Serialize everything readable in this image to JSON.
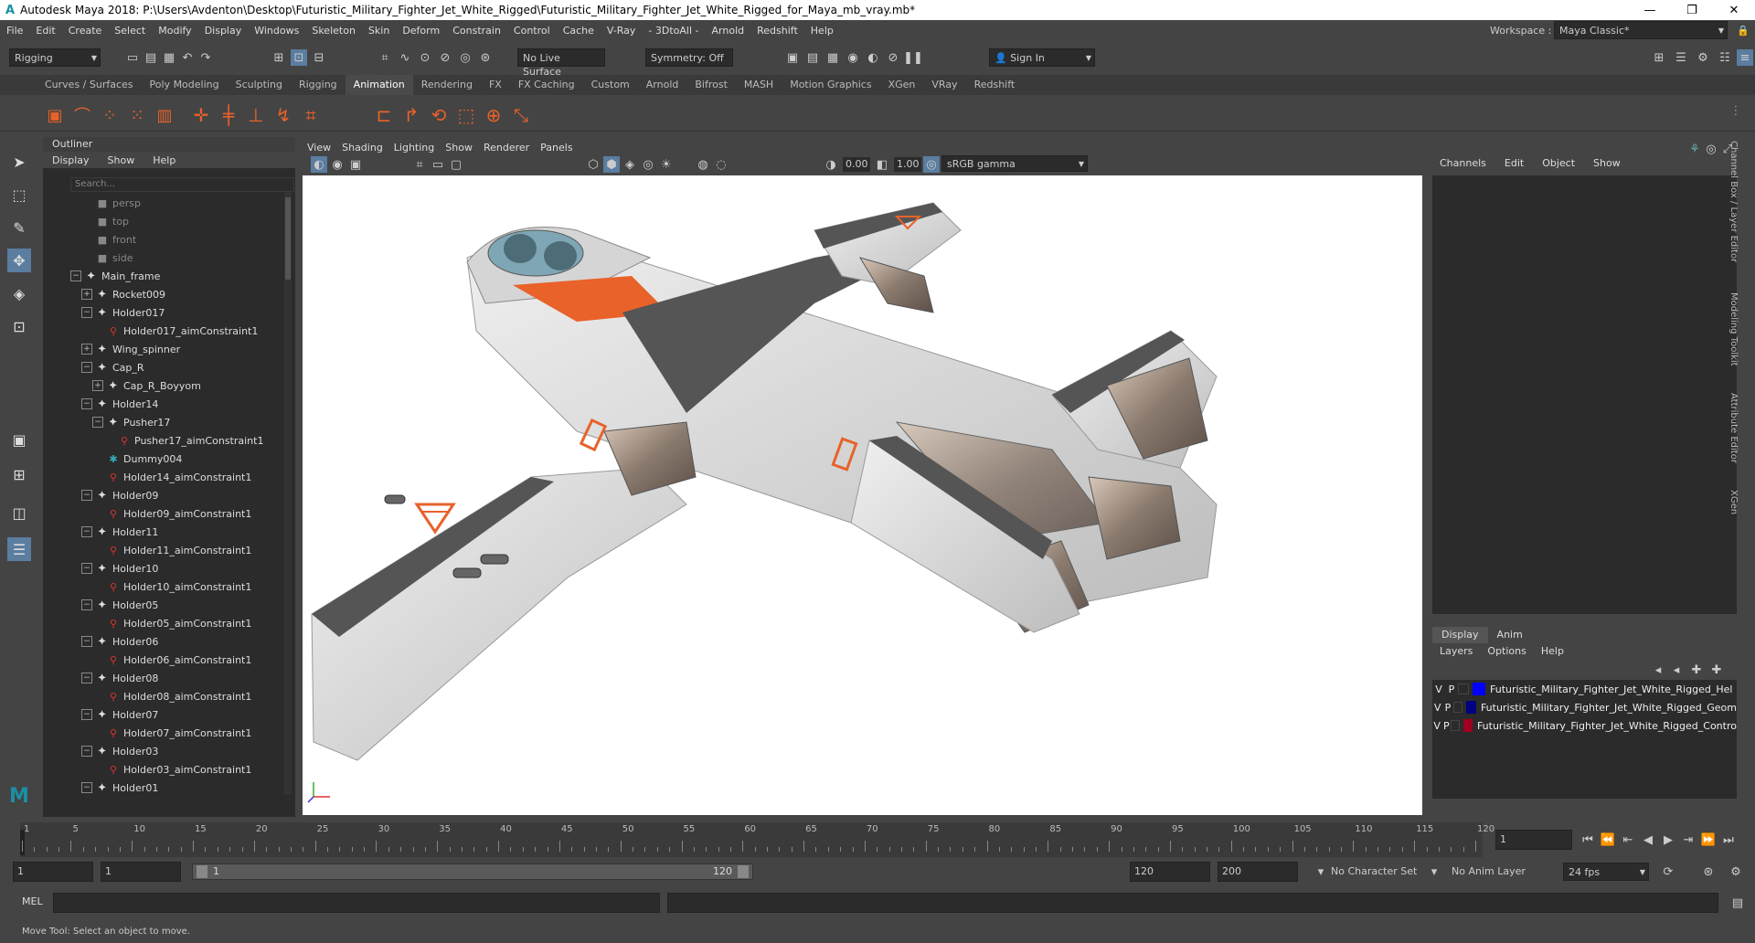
{
  "window": {
    "title": "Autodesk Maya 2018: P:\\Users\\Avdenton\\Desktop\\Futuristic_Military_Fighter_Jet_White_Rigged\\Futuristic_Military_Fighter_Jet_White_Rigged_for_Maya_mb_vray.mb*",
    "logo": "A"
  },
  "menubar": [
    "File",
    "Edit",
    "Create",
    "Select",
    "Modify",
    "Display",
    "Windows",
    "Skeleton",
    "Skin",
    "Deform",
    "Constrain",
    "Control",
    "Cache",
    "V-Ray",
    "- 3DtoAll -",
    "Arnold",
    "Redshift",
    "Help"
  ],
  "workspace": {
    "label": "Workspace :",
    "value": "Maya Classic*"
  },
  "statusline": {
    "mode": "Rigging",
    "live_surface": "No Live Surface",
    "symmetry": "Symmetry: Off",
    "sign_in": "Sign In"
  },
  "shelf_tabs": [
    "Curves / Surfaces",
    "Poly Modeling",
    "Sculpting",
    "Rigging",
    "Animation",
    "Rendering",
    "FX",
    "FX Caching",
    "Custom",
    "Arnold",
    "Bifrost",
    "MASH",
    "Motion Graphics",
    "XGen",
    "VRay",
    "Redshift"
  ],
  "active_shelf_tab": "Animation",
  "outliner": {
    "title": "Outliner",
    "menu": [
      "Display",
      "Show",
      "Help"
    ],
    "search_placeholder": "Search...",
    "items": [
      {
        "label": "persp",
        "depth": 1,
        "icon": "camera",
        "dim": true
      },
      {
        "label": "top",
        "depth": 1,
        "icon": "camera",
        "dim": true
      },
      {
        "label": "front",
        "depth": 1,
        "icon": "camera",
        "dim": true
      },
      {
        "label": "side",
        "depth": 1,
        "icon": "camera",
        "dim": true
      },
      {
        "label": "Main_frame",
        "depth": 0,
        "icon": "transform",
        "expand": "-"
      },
      {
        "label": "Rocket009",
        "depth": 1,
        "icon": "transform",
        "expand": "+"
      },
      {
        "label": "Holder017",
        "depth": 1,
        "icon": "transform",
        "expand": "-"
      },
      {
        "label": "Holder017_aimConstraint1",
        "depth": 2,
        "icon": "constraint"
      },
      {
        "label": "Wing_spinner",
        "depth": 1,
        "icon": "transform",
        "expand": "+"
      },
      {
        "label": "Cap_R",
        "depth": 1,
        "icon": "transform",
        "expand": "-"
      },
      {
        "label": "Cap_R_Boyyom",
        "depth": 2,
        "icon": "transform",
        "expand": "+"
      },
      {
        "label": "Holder14",
        "depth": 1,
        "icon": "transform",
        "expand": "-"
      },
      {
        "label": "Pusher17",
        "depth": 2,
        "icon": "transform",
        "expand": "-"
      },
      {
        "label": "Pusher17_aimConstraint1",
        "depth": 3,
        "icon": "constraint"
      },
      {
        "label": "Dummy004",
        "depth": 2,
        "icon": "locator"
      },
      {
        "label": "Holder14_aimConstraint1",
        "depth": 2,
        "icon": "constraint"
      },
      {
        "label": "Holder09",
        "depth": 1,
        "icon": "transform",
        "expand": "-"
      },
      {
        "label": "Holder09_aimConstraint1",
        "depth": 2,
        "icon": "constraint"
      },
      {
        "label": "Holder11",
        "depth": 1,
        "icon": "transform",
        "expand": "-"
      },
      {
        "label": "Holder11_aimConstraint1",
        "depth": 2,
        "icon": "constraint"
      },
      {
        "label": "Holder10",
        "depth": 1,
        "icon": "transform",
        "expand": "-"
      },
      {
        "label": "Holder10_aimConstraint1",
        "depth": 2,
        "icon": "constraint"
      },
      {
        "label": "Holder05",
        "depth": 1,
        "icon": "transform",
        "expand": "-"
      },
      {
        "label": "Holder05_aimConstraint1",
        "depth": 2,
        "icon": "constraint"
      },
      {
        "label": "Holder06",
        "depth": 1,
        "icon": "transform",
        "expand": "-"
      },
      {
        "label": "Holder06_aimConstraint1",
        "depth": 2,
        "icon": "constraint"
      },
      {
        "label": "Holder08",
        "depth": 1,
        "icon": "transform",
        "expand": "-"
      },
      {
        "label": "Holder08_aimConstraint1",
        "depth": 2,
        "icon": "constraint"
      },
      {
        "label": "Holder07",
        "depth": 1,
        "icon": "transform",
        "expand": "-"
      },
      {
        "label": "Holder07_aimConstraint1",
        "depth": 2,
        "icon": "constraint"
      },
      {
        "label": "Holder03",
        "depth": 1,
        "icon": "transform",
        "expand": "-"
      },
      {
        "label": "Holder03_aimConstraint1",
        "depth": 2,
        "icon": "constraint"
      },
      {
        "label": "Holder01",
        "depth": 1,
        "icon": "transform",
        "expand": "-"
      }
    ]
  },
  "viewport": {
    "menu": [
      "View",
      "Shading",
      "Lighting",
      "Show",
      "Renderer",
      "Panels"
    ],
    "near_value": "0.00",
    "far_value": "1.00",
    "color_space": "sRGB gamma",
    "accent_color": "#e8622a"
  },
  "channelbox": {
    "menu": [
      "Channels",
      "Edit",
      "Object",
      "Show"
    ],
    "layer_tabs": [
      "Display",
      "Anim"
    ],
    "active_layer_tab": "Display",
    "layer_menu": [
      "Layers",
      "Options",
      "Help"
    ],
    "layers": [
      {
        "v": "V",
        "p": "P",
        "color": "#0000ff",
        "name": "Futuristic_Military_Fighter_Jet_White_Rigged_Hel"
      },
      {
        "v": "V",
        "p": "P",
        "color": "#000080",
        "name": "Futuristic_Military_Fighter_Jet_White_Rigged_Geom"
      },
      {
        "v": "V",
        "p": "P",
        "color": "#a00020",
        "name": "Futuristic_Military_Fighter_Jet_White_Rigged_Contro"
      }
    ],
    "side_tabs": [
      "Channel Box / Layer Editor",
      "Modeling Toolkit",
      "Attribute Editor",
      "XGen"
    ]
  },
  "timeline": {
    "ticks": [
      "1",
      "5",
      "10",
      "15",
      "20",
      "25",
      "30",
      "35",
      "40",
      "45",
      "50",
      "55",
      "60",
      "65",
      "70",
      "75",
      "80",
      "85",
      "90",
      "95",
      "100",
      "105",
      "110",
      "115",
      "120"
    ],
    "current_frame": "1"
  },
  "range": {
    "start": "1",
    "playback_start": "1",
    "slider_start": "1",
    "slider_end": "120",
    "playback_end": "120",
    "end": "200",
    "character_set": "No Character Set",
    "anim_layer": "No Anim Layer",
    "fps": "24 fps"
  },
  "command": {
    "lang": "MEL"
  },
  "helpline": "Move Tool: Select an object to move."
}
